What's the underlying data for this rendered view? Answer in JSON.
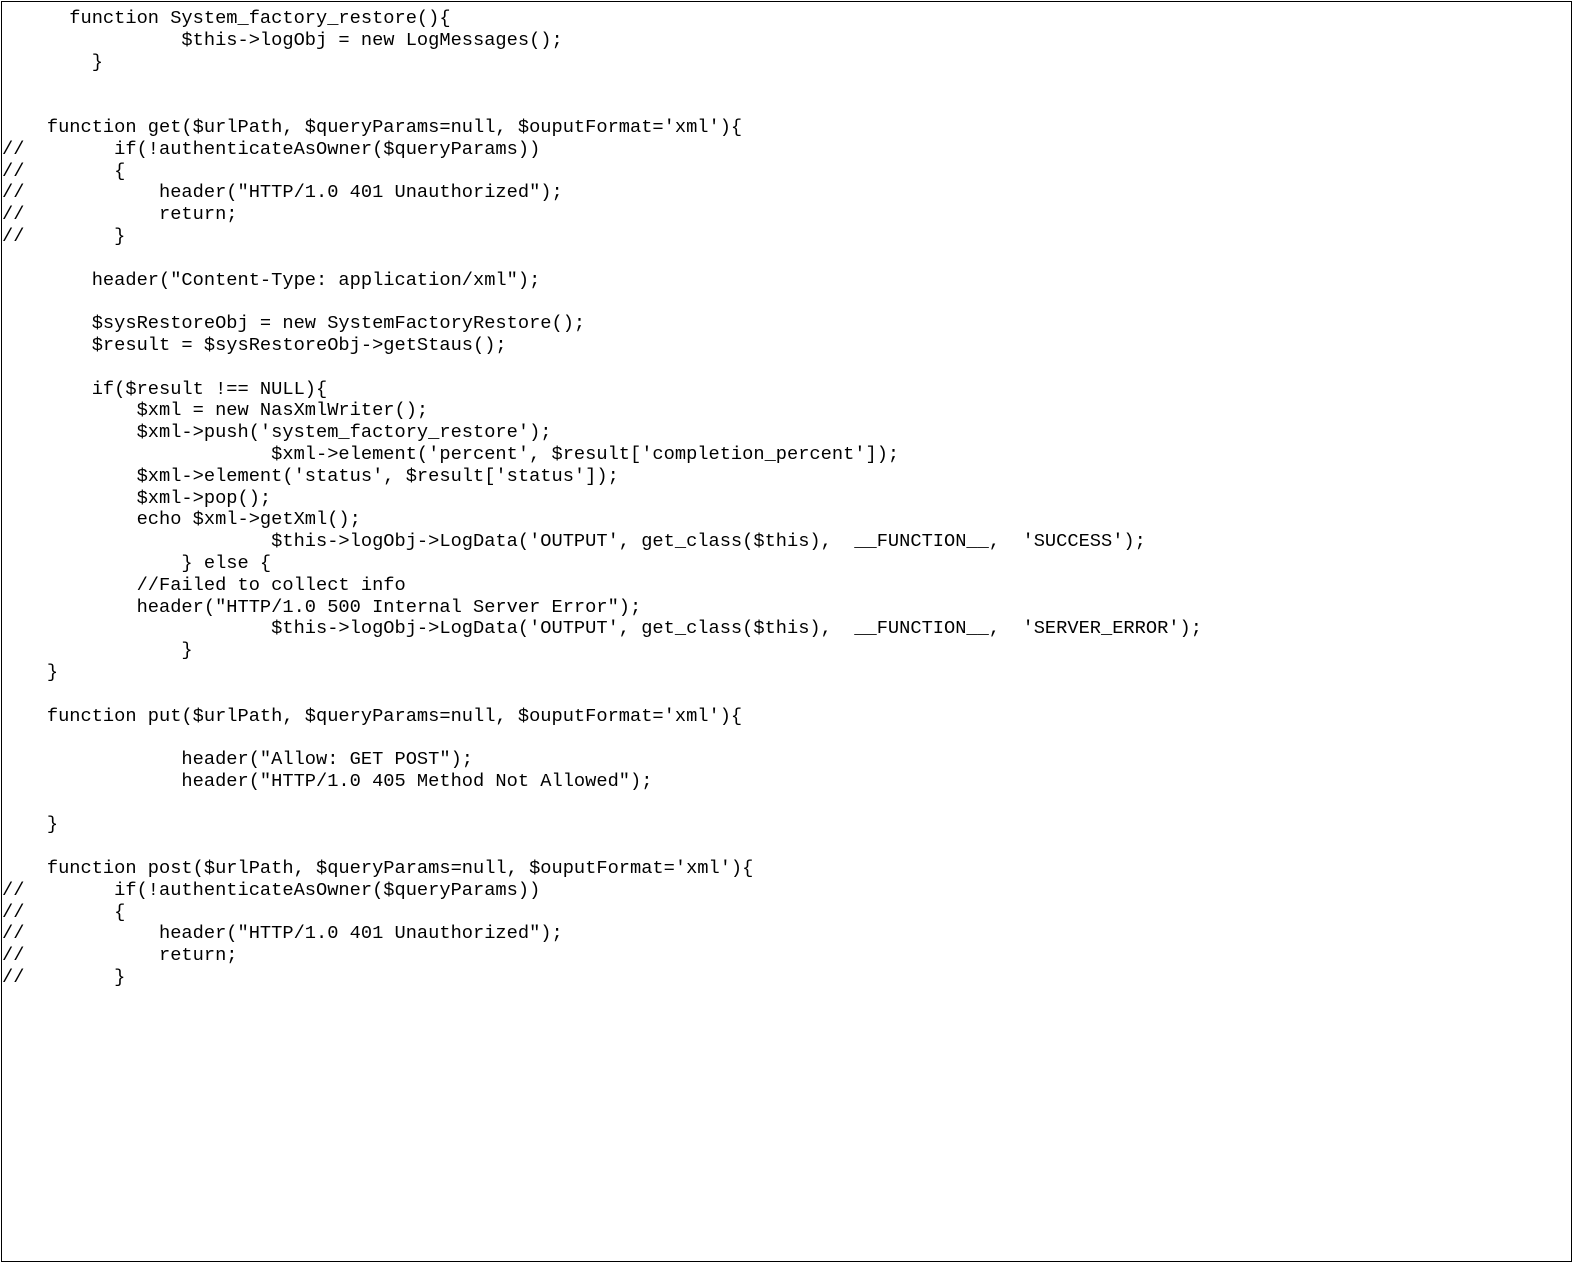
{
  "code_lines": [
    "      function System_factory_restore(){",
    "                $this->logObj = new LogMessages();",
    "        }",
    "",
    "",
    "    function get($urlPath, $queryParams=null, $ouputFormat='xml'){",
    "//        if(!authenticateAsOwner($queryParams))",
    "//        {",
    "//            header(\"HTTP/1.0 401 Unauthorized\");",
    "//            return;",
    "//        }",
    "",
    "        header(\"Content-Type: application/xml\");",
    "",
    "        $sysRestoreObj = new SystemFactoryRestore();",
    "        $result = $sysRestoreObj->getStaus();",
    "",
    "        if($result !== NULL){",
    "            $xml = new NasXmlWriter();",
    "            $xml->push('system_factory_restore');",
    "                        $xml->element('percent', $result['completion_percent']);",
    "            $xml->element('status', $result['status']);",
    "            $xml->pop();",
    "            echo $xml->getXml();",
    "                        $this->logObj->LogData('OUTPUT', get_class($this),  __FUNCTION__,  'SUCCESS');",
    "                } else {",
    "            //Failed to collect info",
    "            header(\"HTTP/1.0 500 Internal Server Error\");",
    "                        $this->logObj->LogData('OUTPUT', get_class($this),  __FUNCTION__,  'SERVER_ERROR');",
    "                }",
    "    }",
    "",
    "    function put($urlPath, $queryParams=null, $ouputFormat='xml'){",
    "",
    "                header(\"Allow: GET POST\");",
    "                header(\"HTTP/1.0 405 Method Not Allowed\");",
    "",
    "    }",
    "",
    "    function post($urlPath, $queryParams=null, $ouputFormat='xml'){",
    "//        if(!authenticateAsOwner($queryParams))",
    "//        {",
    "//            header(\"HTTP/1.0 401 Unauthorized\");",
    "//            return;",
    "//        }"
  ]
}
